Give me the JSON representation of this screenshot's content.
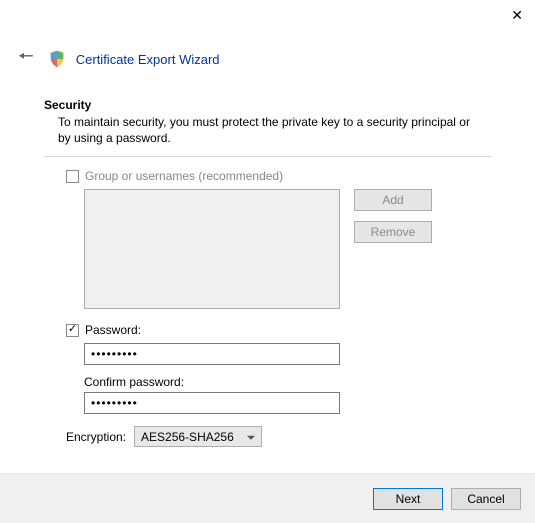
{
  "window": {
    "title": "Certificate Export Wizard"
  },
  "page": {
    "heading": "Security",
    "description": "To maintain security, you must protect the private key to a security principal or by using a password."
  },
  "groupUsers": {
    "label": "Group or usernames (recommended)",
    "checked": false,
    "addLabel": "Add",
    "removeLabel": "Remove"
  },
  "password": {
    "label": "Password:",
    "checked": true,
    "value": "•••••••••",
    "confirmLabel": "Confirm password:",
    "confirmValue": "•••••••••"
  },
  "encryption": {
    "label": "Encryption:",
    "selected": "AES256-SHA256"
  },
  "footer": {
    "next": "Next",
    "cancel": "Cancel"
  }
}
